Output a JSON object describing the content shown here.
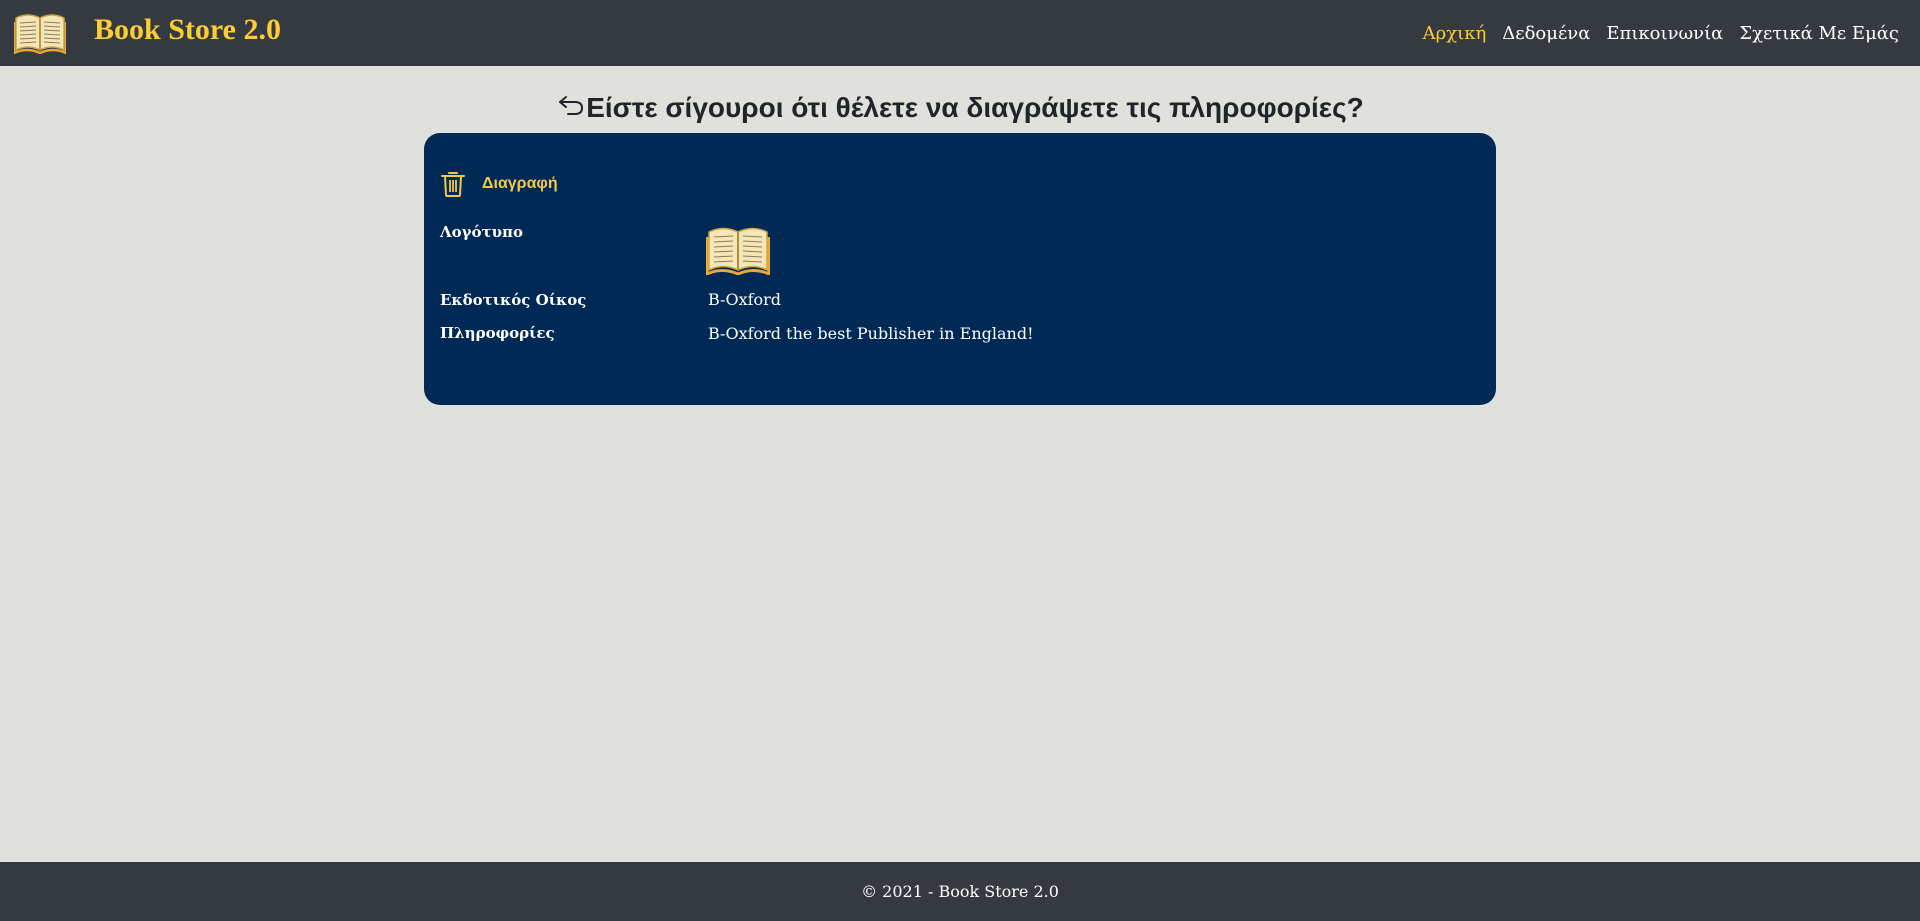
{
  "navbar": {
    "brand_name": "Book Store 2.0",
    "brand_icon": "open-book-icon",
    "links": [
      {
        "label": "Αρχική",
        "active": true
      },
      {
        "label": "Δεδομένα",
        "active": false
      },
      {
        "label": "Επικοινωνία",
        "active": false
      },
      {
        "label": "Σχετικά Με Εμάς",
        "active": false
      }
    ]
  },
  "page": {
    "back_icon": "back-arrow-icon",
    "heading": "Είστε σίγουροι ότι θέλετε να διαγράψετε τις πληροφορίες?"
  },
  "card": {
    "delete_label": "Διαγραφή",
    "delete_icon": "trash-icon",
    "fields": {
      "logo_label": "Λογότυπο",
      "logo_icon": "open-book-icon",
      "publisher_label": "Εκδοτικός Οίκος",
      "publisher_value": "B-Oxford",
      "info_label": "Πληροφορίες",
      "info_value": "B-Oxford the best Publisher in England!"
    }
  },
  "footer": {
    "text": "© 2021 - Book Store 2.0"
  },
  "colors": {
    "navbar_bg": "#343a40",
    "accent": "#ffcc33",
    "card_bg": "#002955",
    "page_bg": "#e0e1dc"
  }
}
